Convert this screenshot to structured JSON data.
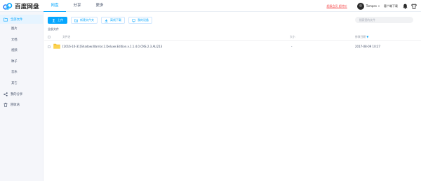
{
  "app": {
    "logo_text": "百度网盘"
  },
  "nav": {
    "tabs": [
      {
        "label": "网盘",
        "active": true
      },
      {
        "label": "分享",
        "active": false
      },
      {
        "label": "更多",
        "active": false
      }
    ]
  },
  "header": {
    "promo": "超级会员 超特价",
    "username": "Tompes",
    "download_client": "客户端下载",
    "icons": [
      "bell-icon",
      "shirt-icon"
    ]
  },
  "sidebar": {
    "main_item": {
      "label": "全部文件",
      "icon": "folder-icon"
    },
    "sub_items": [
      "图片",
      "文档",
      "视频",
      "种子",
      "音乐",
      "其它"
    ],
    "items": [
      {
        "label": "我的分享",
        "icon": "share-icon"
      },
      {
        "label": "回收站",
        "icon": "trash-icon"
      }
    ]
  },
  "toolbar": {
    "upload": "上传",
    "new_folder": "新建文件夹",
    "offline_download": "离线下载",
    "my_devices": "我的设备"
  },
  "search": {
    "placeholder": "搜索您的文件"
  },
  "breadcrumb": "全部文件",
  "table": {
    "columns": {
      "name": "文件名",
      "size": "大小",
      "date": "修改日期",
      "sort_indicator": "▼"
    },
    "rows": [
      {
        "name": "[2016-10-31]Shadow.Warrior.2.Deluxe.Edition.v.1.1.4.0.CNS.2.3.ALI213",
        "size": "-",
        "date": "2017-08-09 10:27"
      }
    ]
  },
  "colors": {
    "accent": "#06a7ff",
    "promo": "#f54d4f",
    "folder": "#f6c234",
    "sidebar_bg": "#f5f6fa"
  }
}
